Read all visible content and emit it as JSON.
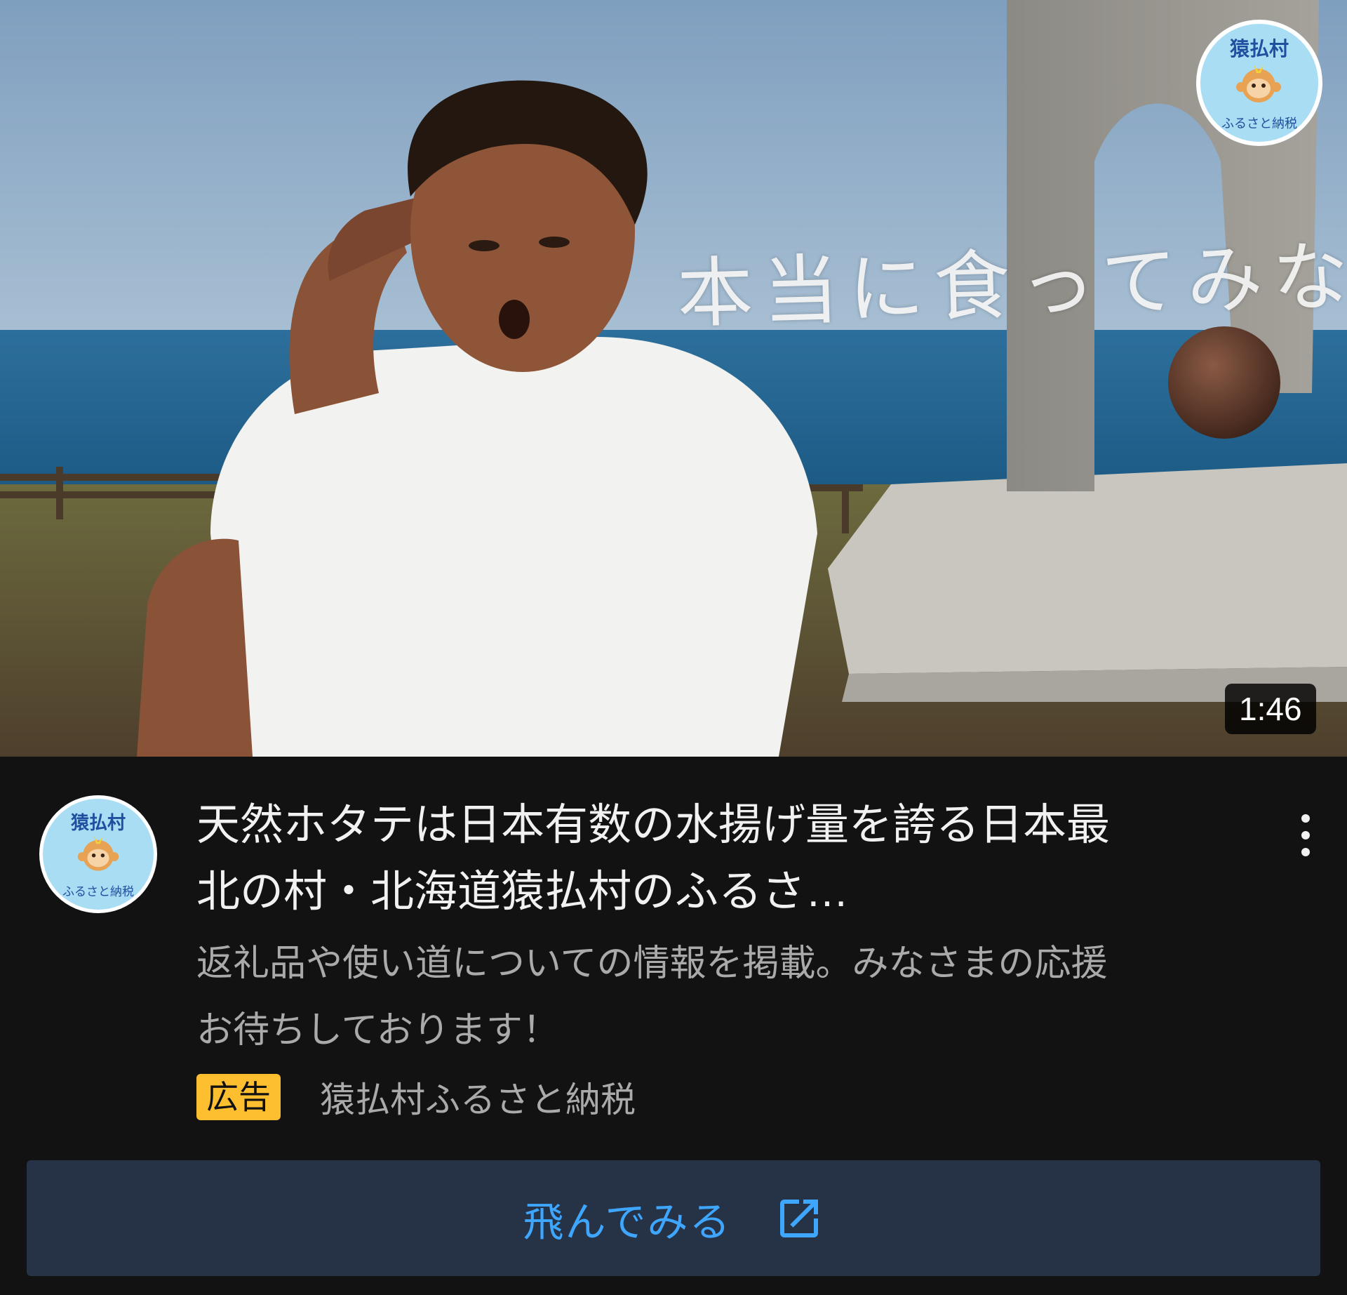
{
  "thumbnail": {
    "overlay_text": "本当に食ってみな！",
    "duration": "1:46",
    "logo": {
      "title": "猿払村",
      "subtitle": "ふるさと納税"
    }
  },
  "video": {
    "title": "天然ホタテは日本有数の水揚げ量を誇る日本最北の村・北海道猿払村のふるさ…",
    "description": "返礼品や使い道についての情報を掲載。みなさまの応援お待ちしております！",
    "ad_label": "広告",
    "advertiser": "猿払村ふるさと納税"
  },
  "channel_avatar": {
    "title": "猿払村",
    "subtitle": "ふるさと納税"
  },
  "cta": {
    "label": "飛んでみる",
    "icon": "open-in-new-icon"
  },
  "menu": {
    "icon": "more-vert-icon"
  },
  "colors": {
    "background": "#121212",
    "ad_badge": "#fdbf2f",
    "cta_background": "#263245",
    "cta_text": "#3ea6ff"
  }
}
